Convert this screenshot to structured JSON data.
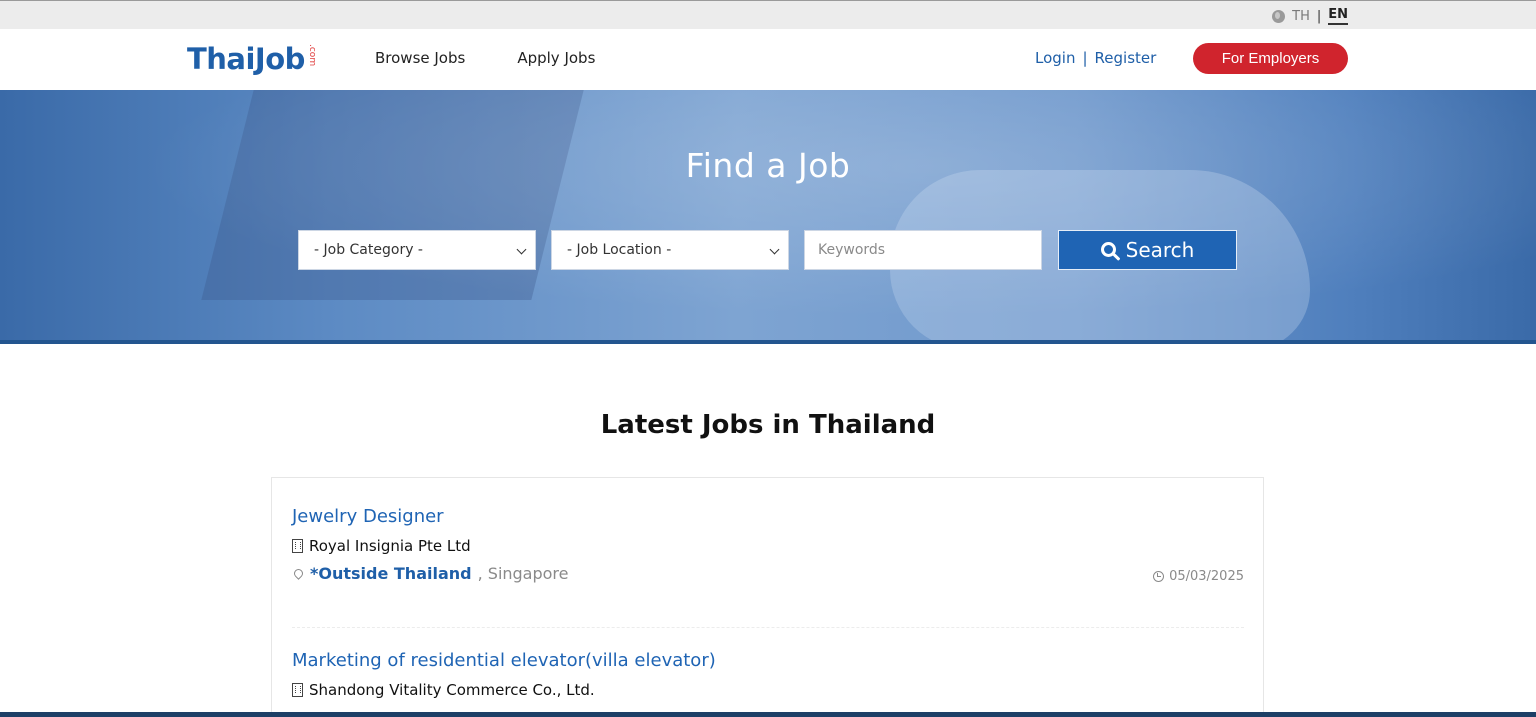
{
  "language": {
    "options": [
      "TH",
      "EN"
    ],
    "selected": "EN",
    "icon": "globe-icon"
  },
  "header": {
    "logo": "ThaiJob",
    "logo_suffix": ".com",
    "nav": [
      "Browse Jobs",
      "Apply Jobs"
    ],
    "login": "Login",
    "register": "Register",
    "employer_button": "For Employers"
  },
  "hero": {
    "title": "Find a Job",
    "category_select": "- Job Category -",
    "location_select": "- Job Location -",
    "keywords_placeholder": "Keywords",
    "search_button": "Search",
    "search_icon": "search-icon"
  },
  "content": {
    "section_title": "Latest Jobs in Thailand",
    "jobs": [
      {
        "title": "Jewelry Designer",
        "company": "Royal Insignia Pte Ltd",
        "location": "*Outside Thailand",
        "sublocation": ", Singapore",
        "date": "05/03/2025"
      },
      {
        "title": "Marketing of residential elevator(villa elevator)",
        "company": "Shandong Vitality Commerce Co., Ltd."
      }
    ]
  },
  "colors": {
    "brand_blue": "#1f5fa8",
    "employer_red": "#d0242d",
    "search_blue": "#1f64b4"
  }
}
